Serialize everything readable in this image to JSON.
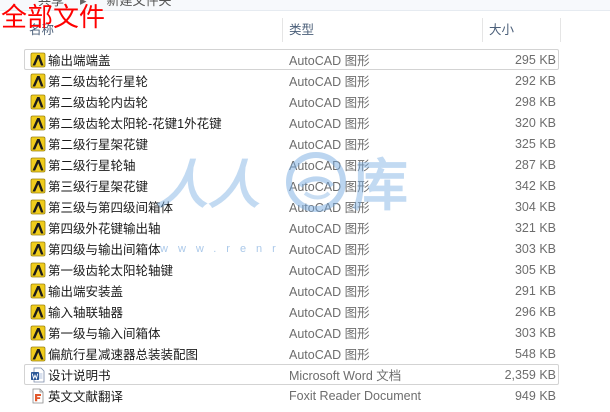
{
  "breadcrumb": {
    "items": [
      "共享",
      "新建文件夹"
    ],
    "separator": "▸"
  },
  "overlay_title": "全部文件",
  "columns": {
    "name": "名称",
    "type": "类型",
    "size": "大小"
  },
  "files": [
    {
      "name": "输出端端盖",
      "type": "AutoCAD 图形",
      "size": "295 KB",
      "icon": "autocad-drawing-icon",
      "highlighted": true
    },
    {
      "name": "第二级齿轮行星轮",
      "type": "AutoCAD 图形",
      "size": "292 KB",
      "icon": "autocad-drawing-icon"
    },
    {
      "name": "第二级齿轮内齿轮",
      "type": "AutoCAD 图形",
      "size": "298 KB",
      "icon": "autocad-drawing-icon"
    },
    {
      "name": "第二级齿轮太阳轮-花键1外花键",
      "type": "AutoCAD 图形",
      "size": "320 KB",
      "icon": "autocad-drawing-icon"
    },
    {
      "name": "第二级行星架花键",
      "type": "AutoCAD 图形",
      "size": "325 KB",
      "icon": "autocad-drawing-icon"
    },
    {
      "name": "第二级行星轮轴",
      "type": "AutoCAD 图形",
      "size": "287 KB",
      "icon": "autocad-drawing-icon"
    },
    {
      "name": "第三级行星架花键",
      "type": "AutoCAD 图形",
      "size": "342 KB",
      "icon": "autocad-drawing-icon"
    },
    {
      "name": "第三级与第四级间箱体",
      "type": "AutoCAD 图形",
      "size": "304 KB",
      "icon": "autocad-drawing-icon"
    },
    {
      "name": "第四级外花键输出轴",
      "type": "AutoCAD 图形",
      "size": "321 KB",
      "icon": "autocad-drawing-icon"
    },
    {
      "name": "第四级与输出间箱体",
      "type": "AutoCAD 图形",
      "size": "303 KB",
      "icon": "autocad-drawing-icon"
    },
    {
      "name": "第一级齿轮太阳轮轴键",
      "type": "AutoCAD 图形",
      "size": "305 KB",
      "icon": "autocad-drawing-icon"
    },
    {
      "name": "输出端安装盖",
      "type": "AutoCAD 图形",
      "size": "291 KB",
      "icon": "autocad-drawing-icon"
    },
    {
      "name": "输入轴联轴器",
      "type": "AutoCAD 图形",
      "size": "296 KB",
      "icon": "autocad-drawing-icon"
    },
    {
      "name": "第一级与输入间箱体",
      "type": "AutoCAD 图形",
      "size": "303 KB",
      "icon": "autocad-drawing-icon"
    },
    {
      "name": "偏航行星减速器总装装配图",
      "type": "AutoCAD 图形",
      "size": "548 KB",
      "icon": "autocad-drawing-icon"
    },
    {
      "name": "设计说明书",
      "type": "Microsoft Word 文档",
      "size": "2,359 KB",
      "icon": "word-document-icon",
      "highlighted": true
    },
    {
      "name": "英文文献翻译",
      "type": "Foxit Reader Document",
      "size": "949 KB",
      "icon": "foxit-pdf-document-icon"
    }
  ],
  "watermark": {
    "left_text": "人人",
    "right_text": "库",
    "url_text": "www.renr"
  },
  "colors": {
    "overlay_title": "#ff0000",
    "watermark": "#78ace2",
    "header_text": "#4c607a",
    "secondary_text": "#6d6d6d",
    "highlight_border": "#d3d3d3"
  }
}
